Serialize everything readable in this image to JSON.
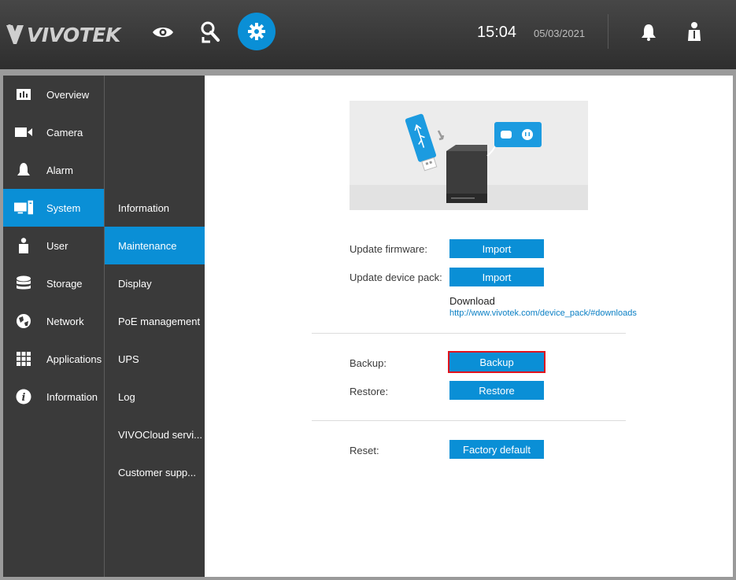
{
  "header": {
    "logo_text": "VIVOTEK",
    "time": "15:04",
    "date": "05/03/2021",
    "icons": [
      "eye-icon",
      "search-person-icon",
      "gear-icon",
      "bell-icon",
      "user-icon"
    ]
  },
  "sidebar": {
    "items": [
      {
        "label": "Overview",
        "icon": "overview-icon"
      },
      {
        "label": "Camera",
        "icon": "camera-icon"
      },
      {
        "label": "Alarm",
        "icon": "alarm-icon"
      },
      {
        "label": "System",
        "icon": "system-icon",
        "active": true
      },
      {
        "label": "User",
        "icon": "user-icon"
      },
      {
        "label": "Storage",
        "icon": "storage-icon"
      },
      {
        "label": "Network",
        "icon": "network-icon"
      },
      {
        "label": "Applications",
        "icon": "applications-icon"
      },
      {
        "label": "Information",
        "icon": "information-icon"
      }
    ]
  },
  "submenu": {
    "items": [
      {
        "label": "Information"
      },
      {
        "label": "Maintenance",
        "active": true
      },
      {
        "label": "Display"
      },
      {
        "label": "PoE management"
      },
      {
        "label": "UPS"
      },
      {
        "label": "Log"
      },
      {
        "label": "VIVOCloud servi..."
      },
      {
        "label": "Customer supp..."
      }
    ]
  },
  "maintenance": {
    "update_firmware_label": "Update firmware:",
    "update_firmware_button": "Import",
    "update_device_pack_label": "Update device pack:",
    "update_device_pack_button": "Import",
    "download_label": "Download",
    "download_link": "http://www.vivotek.com/device_pack/#downloads",
    "backup_label": "Backup:",
    "backup_button": "Backup",
    "restore_label": "Restore:",
    "restore_button": "Restore",
    "reset_label": "Reset:",
    "reset_button": "Factory default"
  },
  "colors": {
    "accent": "#0a8fd6",
    "highlight": "#e0141e",
    "panel": "#3a3a3a"
  }
}
